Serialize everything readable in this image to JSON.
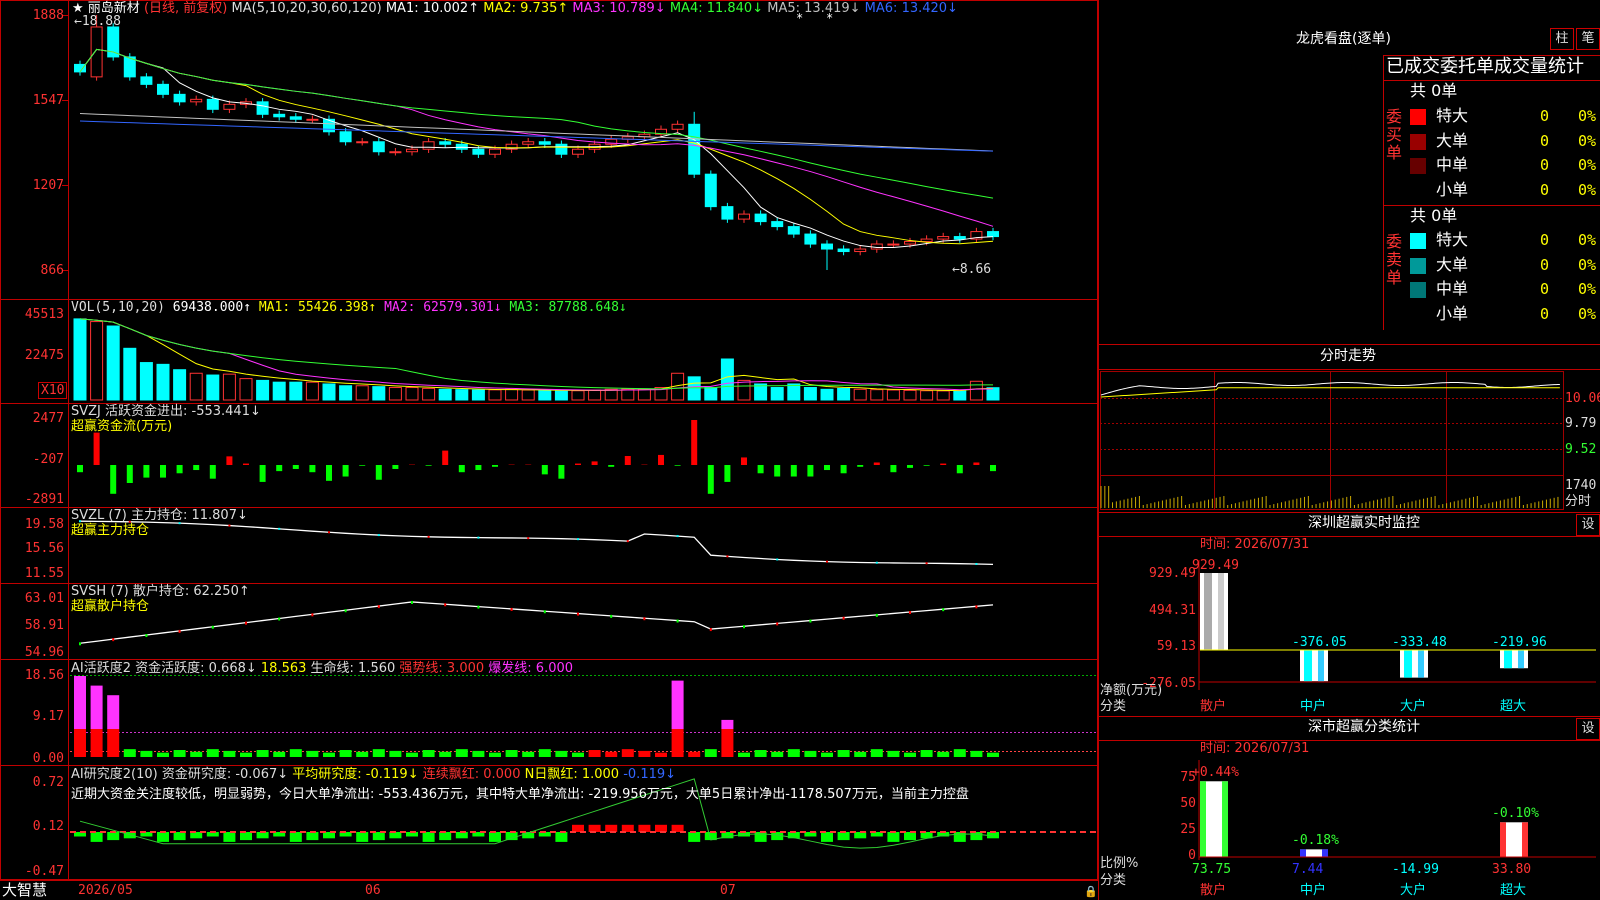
{
  "app": {
    "brand": "大智慧"
  },
  "stock": {
    "header_star": "★",
    "name": "丽岛新材",
    "mode": "(日线, 前复权)",
    "ma_label": "MA(5,10,20,30,60,120)",
    "ma_values": [
      {
        "label": "MA1: 10.002↑",
        "color": "#ffffff"
      },
      {
        "label": "MA2: 9.735↑",
        "color": "#ffff00"
      },
      {
        "label": "MA3: 10.789↓",
        "color": "#ff33ff"
      },
      {
        "label": "MA4: 11.840↓",
        "color": "#33ff33"
      },
      {
        "label": "MA5: 13.419↓",
        "color": "#c0c0c0"
      },
      {
        "label": "MA6: 13.420↓",
        "color": "#3366ff"
      }
    ],
    "high_marker": "←18.88",
    "low_marker": "←8.66"
  },
  "price_axis": [
    "1888",
    "1547",
    "1207",
    "866"
  ],
  "volume": {
    "header": "VOL(5,10,20)",
    "value": "69438.000↑",
    "ma1": "MA1: 55426.398↑",
    "ma2": "MA2: 62579.301↓",
    "ma3": "MA3: 87788.648↓",
    "axis": [
      "45513",
      "22475"
    ],
    "unit": "X10"
  },
  "svzj": {
    "header": "SVZJ  活跃资金进出: -553.441↓",
    "sub": "超赢资金流(万元)",
    "axis": [
      "2477",
      "-207",
      "-2891"
    ]
  },
  "svzl": {
    "header": "SVZL (7) 主力持仓: 11.807↓",
    "sub": "超赢主力持仓",
    "axis": [
      "19.58",
      "15.56",
      "11.55"
    ]
  },
  "svsh": {
    "header": "SVSH (7) 散户持仓: 62.250↑",
    "sub": "超赢散户持仓",
    "axis": [
      "63.01",
      "58.91",
      "54.96"
    ]
  },
  "ai_active": {
    "h1": "AI活跃度2 资金活跃度: 0.668↓",
    "h2": "18.563",
    "h3": "生命线: 1.560",
    "h4": "强势线: 3.000",
    "h5": "爆发线: 6.000",
    "axis": [
      "18.56",
      "9.17",
      "0.00"
    ]
  },
  "ai_research": {
    "h1": "AI研究度2(10) 资金研究度: -0.067↓",
    "h2": "平均研究度: -0.119↓",
    "h3": "连续飘红: 0.000",
    "h4": "N日飘红: 1.000",
    "h5": "-0.119↓",
    "text": "近期大资金关注度较低，明显弱势，今日大单净流出: -553.436万元，其中特大单净流出: -219.956万元，大单5日累计净出-1178.507万元，当前主力控盘",
    "axis": [
      "0.72",
      "0.12",
      "-0.47"
    ]
  },
  "date_axis": [
    "2026/05",
    "06",
    "07"
  ],
  "dragon": {
    "title": "龙虎看盘(逐单)",
    "btn_column": "柱",
    "btn_pen": "笔",
    "subtitle": "已成交委托单成交量统计",
    "buy_side": "委买单",
    "sell_side": "委卖单",
    "buy_total": "共 0单",
    "sell_total": "共 0单",
    "buy_rows": [
      {
        "label": "特大",
        "count": "0",
        "pct": "0%",
        "color": "#ff0000"
      },
      {
        "label": "大单",
        "count": "0",
        "pct": "0%",
        "color": "#990000"
      },
      {
        "label": "中单",
        "count": "0",
        "pct": "0%",
        "color": "#660000"
      },
      {
        "label": "小单",
        "count": "0",
        "pct": "0%",
        "color": ""
      }
    ],
    "sell_rows": [
      {
        "label": "特大",
        "count": "0",
        "pct": "0%",
        "color": "#00ffff"
      },
      {
        "label": "大单",
        "count": "0",
        "pct": "0%",
        "color": "#009999"
      },
      {
        "label": "中单",
        "count": "0",
        "pct": "0%",
        "color": "#007777"
      },
      {
        "label": "小单",
        "count": "0",
        "pct": "0%",
        "color": ""
      }
    ]
  },
  "intraday": {
    "title": "分时走势",
    "axis": [
      "10.06",
      "9.79",
      "9.52"
    ],
    "vol_value": "1740",
    "vol_unit": "分时"
  },
  "sz_monitor": {
    "title": "深圳超赢实时监控",
    "settings": "设",
    "time": "时间: 2026/07/31",
    "axis": [
      "929.49",
      "494.31",
      "59.13",
      "-276.05"
    ],
    "ylabel": "净额(万元)",
    "xlabel": "分类",
    "categories": [
      "散户",
      "中户",
      "大户",
      "超大"
    ],
    "values": [
      929.49,
      -376.05,
      -333.48,
      -219.96
    ],
    "labels": [
      "929.49",
      "-376.05",
      "-333.48",
      "-219.96"
    ]
  },
  "sz_class": {
    "title": "深市超赢分类统计",
    "settings": "设",
    "time": "时间: 2026/07/31",
    "axis": [
      "75",
      "50",
      "25",
      "0"
    ],
    "ylabel": "比例%",
    "xlabel": "分类",
    "categories": [
      "散户",
      "中户",
      "大户",
      "超大"
    ],
    "values": [
      73.75,
      7.44,
      -14.99,
      33.8
    ],
    "value_labels": [
      "73.75",
      "7.44",
      "-14.99",
      "33.80"
    ],
    "pct_labels": [
      "+0.44%",
      "-0.18%",
      "",
      "-0.10%"
    ]
  },
  "chart_data": [
    {
      "type": "candlestick",
      "title": "丽岛新材 (日线, 前复权)",
      "x_range": [
        "2026/05",
        "2026/07"
      ],
      "ylim": [
        8.66,
        18.88
      ],
      "annotations": [
        "←18.88",
        "←8.66"
      ],
      "close_approx": [
        16.6,
        18.4,
        17.2,
        16.4,
        16.1,
        15.7,
        15.4,
        15.5,
        15.1,
        15.3,
        15.4,
        14.9,
        14.8,
        14.7,
        14.7,
        14.2,
        13.8,
        13.8,
        13.4,
        13.4,
        13.5,
        13.8,
        13.7,
        13.5,
        13.3,
        13.5,
        13.7,
        13.8,
        13.7,
        13.3,
        13.5,
        13.7,
        13.9,
        14.0,
        14.1,
        14.3,
        14.5,
        12.5,
        11.2,
        10.7,
        10.9,
        10.6,
        10.4,
        10.1,
        9.7,
        9.5,
        9.4,
        9.5,
        9.7,
        9.7,
        9.8,
        9.9,
        10.0,
        9.9,
        10.2,
        10.0
      ],
      "ma": {
        "MA1": 10.002,
        "MA2": 9.735,
        "MA3": 10.789,
        "MA4": 11.84,
        "MA5": 13.419,
        "MA6": 13.42
      }
    },
    {
      "type": "bar",
      "title": "VOL(5,10,20)",
      "unit": "X10",
      "values_approx": [
        4550,
        4400,
        4150,
        2900,
        2100,
        2000,
        1700,
        1500,
        1400,
        1450,
        1200,
        1100,
        1000,
        1000,
        1000,
        900,
        800,
        800,
        750,
        700,
        700,
        650,
        600,
        580,
        560,
        570,
        600,
        560,
        520,
        500,
        520,
        560,
        600,
        620,
        620,
        700,
        1500,
        1300,
        700,
        2300,
        1100,
        900,
        700,
        900,
        700,
        600,
        650,
        600,
        580,
        560,
        540,
        520,
        510,
        500,
        1050,
        690
      ],
      "ma": {
        "MA1": 55426.398,
        "MA2": 62579.301,
        "MA3": 87788.648
      }
    },
    {
      "type": "bar",
      "title": "SVZJ 活跃资金进出",
      "ylabel": "超赢资金流(万元)",
      "ylim": [
        -2891,
        2477
      ],
      "last": -553.441
    },
    {
      "type": "line",
      "title": "SVZL (7) 主力持仓",
      "ylim": [
        11.55,
        19.58
      ],
      "last": 11.807
    },
    {
      "type": "line",
      "title": "SVSH (7) 散户持仓",
      "ylim": [
        54.96,
        63.01
      ],
      "last": 62.25
    },
    {
      "type": "bar",
      "title": "AI活跃度2 资金活跃度",
      "ylim": [
        0,
        18.56
      ],
      "last": 0.668,
      "lines": {
        "生命线": 1.56,
        "强势线": 3.0,
        "爆发线": 6.0
      }
    },
    {
      "type": "bar",
      "title": "AI研究度2(10) 资金研究度",
      "ylim": [
        -0.47,
        0.72
      ],
      "last": -0.067,
      "average": -0.119
    },
    {
      "type": "bar",
      "title": "深圳超赢实时监控",
      "categories": [
        "散户",
        "中户",
        "大户",
        "超大"
      ],
      "values": [
        929.49,
        -376.05,
        -333.48,
        -219.96
      ],
      "ylabel": "净额(万元)",
      "xlabel": "分类",
      "ylim": [
        -276.05,
        929.49
      ]
    },
    {
      "type": "bar",
      "title": "深市超赢分类统计",
      "categories": [
        "散户",
        "中户",
        "大户",
        "超大"
      ],
      "values": [
        73.75,
        7.44,
        -14.99,
        33.8
      ],
      "change": [
        "+0.44%",
        "-0.18%",
        "",
        "-0.10%"
      ],
      "ylabel": "比例%",
      "xlabel": "分类",
      "ylim": [
        0,
        75
      ]
    }
  ]
}
